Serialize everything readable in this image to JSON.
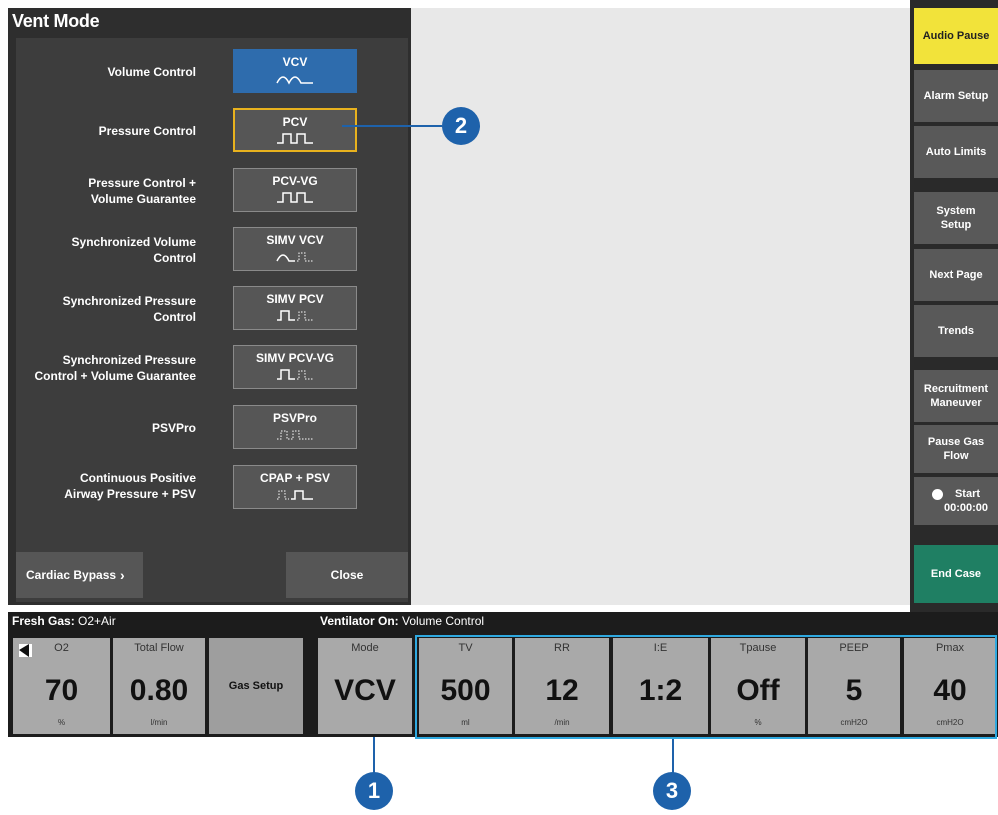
{
  "vent_mode": {
    "title": "Vent Mode",
    "modes": [
      {
        "label": "Volume Control",
        "button": "VCV"
      },
      {
        "label": "Pressure Control",
        "button": "PCV"
      },
      {
        "label": "Pressure Control +\nVolume Guarantee",
        "button": "PCV-VG"
      },
      {
        "label": "Synchronized Volume\nControl",
        "button": "SIMV VCV"
      },
      {
        "label": "Synchronized Pressure\nControl",
        "button": "SIMV PCV"
      },
      {
        "label": "Synchronized Pressure\nControl + Volume Guarantee",
        "button": "SIMV PCV-VG"
      },
      {
        "label": "PSVPro",
        "button": "PSVPro"
      },
      {
        "label": "Continuous Positive\nAirway Pressure + PSV",
        "button": "CPAP + PSV"
      }
    ],
    "cardiac_bypass": "Cardiac Bypass",
    "close": "Close"
  },
  "sidebar": {
    "audio_pause": "Audio Pause",
    "alarm_setup": "Alarm Setup",
    "auto_limits": "Auto Limits",
    "system_setup": "System\nSetup",
    "next_page": "Next Page",
    "trends": "Trends",
    "recruitment": "Recruitment\nManeuver",
    "pause_gas": "Pause Gas\nFlow",
    "timer_label": "Start",
    "timer_value": "00:00:00",
    "end_case": "End Case"
  },
  "fresh_gas": {
    "header_label": "Fresh Gas:",
    "header_value": " O2+Air",
    "o2": {
      "title": "O2",
      "value": "70",
      "unit": "%"
    },
    "total_flow": {
      "title": "Total Flow",
      "value": "0.80",
      "unit": "l/min"
    },
    "gas_setup": "Gas Setup"
  },
  "ventilator": {
    "header_label": "Ventilator On:",
    "header_value": " Volume Control",
    "mode": {
      "title": "Mode",
      "value": "VCV"
    },
    "params": [
      {
        "title": "TV",
        "value": "500",
        "unit": "ml"
      },
      {
        "title": "RR",
        "value": "12",
        "unit": "/min"
      },
      {
        "title": "I:E",
        "value": "1:2",
        "unit": ""
      },
      {
        "title": "Tpause",
        "value": "Off",
        "unit": "%"
      },
      {
        "title": "PEEP",
        "value": "5",
        "unit": "cmH2O"
      },
      {
        "title": "Pmax",
        "value": "40",
        "unit": "cmH2O"
      }
    ]
  },
  "callouts": [
    "1",
    "2",
    "3"
  ],
  "colors": {
    "active_mode": "#2e6cad",
    "highlight_border": "#e8b21e",
    "audio_pause": "#f2e33a",
    "end_case": "#1f7f63",
    "callout": "#1e62ab",
    "outline": "#2fa9e0"
  }
}
